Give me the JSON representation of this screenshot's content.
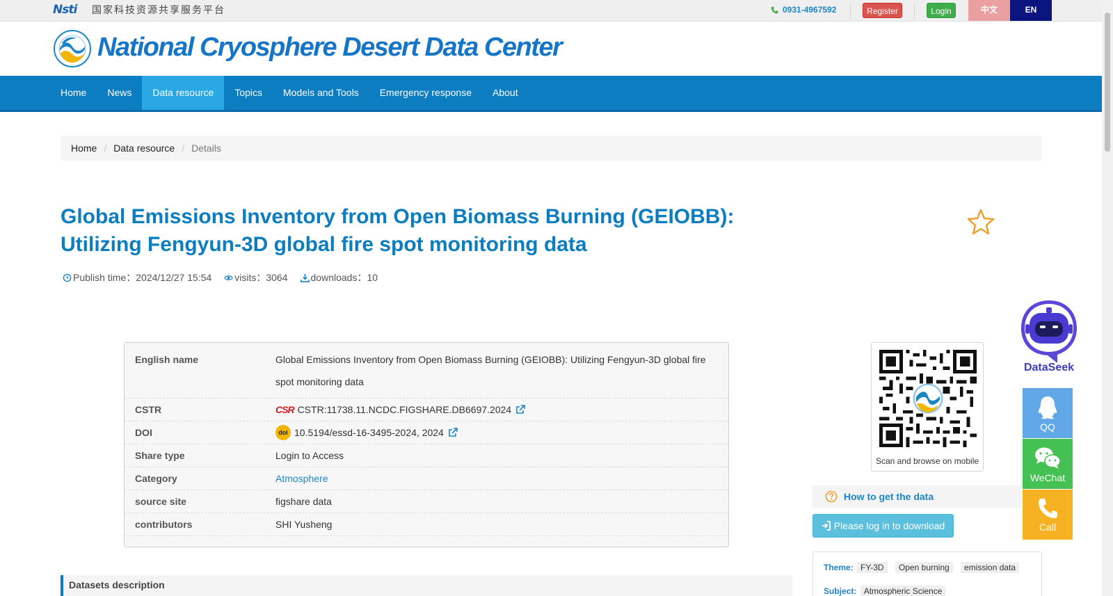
{
  "topbar": {
    "logo_mark": "Nsti",
    "logo_text": "国家科技资源共享服务平台",
    "phone": "0931-4967592",
    "register_label": "Register",
    "login_label": "Login",
    "lang_zh": "中文",
    "lang_en": "EN"
  },
  "header": {
    "site_title": "National Cryosphere Desert Data Center"
  },
  "nav": {
    "items": [
      {
        "label": "Home"
      },
      {
        "label": "News"
      },
      {
        "label": "Data resource"
      },
      {
        "label": "Topics"
      },
      {
        "label": "Models and Tools"
      },
      {
        "label": "Emergency response"
      },
      {
        "label": "About"
      }
    ],
    "active_index": 2
  },
  "breadcrumb": {
    "home": "Home",
    "section": "Data resource",
    "current": "Details"
  },
  "dataset": {
    "title": "Global Emissions Inventory from Open Biomass Burning (GEIOBB): Utilizing Fengyun-3D global fire spot monitoring data",
    "publish_time": "Publish time：2024/12/27 15:54",
    "visits": "visits：3064",
    "downloads": "downloads：10"
  },
  "info": {
    "english_name_key": "English name",
    "english_name": "Global Emissions Inventory from Open Biomass Burning (GEIOBB): Utilizing Fengyun-3D global fire spot monitoring data",
    "cstr_key": "CSTR",
    "cstr_badge": "CSR",
    "cstr": "CSTR:11738.11.NCDC.FIGSHARE.DB6697.2024",
    "doi_key": "DOI",
    "doi_badge": "doi",
    "doi": "10.5194/essd-16-3495-2024, 2024",
    "share_type_key": "Share type",
    "share_type": "Login to Access",
    "category_key": "Category",
    "category": "Atmosphere",
    "source_site_key": "source site",
    "source_site": "figshare data",
    "contributors_key": "contributors",
    "contributors": "SHI Yusheng"
  },
  "sections": {
    "description_title": "Datasets description"
  },
  "sidebar": {
    "qr_caption": "Scan and browse on mobile",
    "how_to_get": "How to get the data",
    "download_label": "Please log in to download",
    "theme_label": "Theme:",
    "themes": [
      "FY-3D",
      "Open burning",
      "emission data"
    ],
    "subject_label": "Subject:",
    "subject": "Atmospheric Science"
  },
  "floating": {
    "dataseek": "DataSeek",
    "qq": "QQ",
    "wechat": "WeChat",
    "call": "Call"
  },
  "colors": {
    "primary": "#0b7dc0",
    "nav_active": "#2aa7e5",
    "register": "#d9534f",
    "login": "#3fae4a",
    "lang_en": "#0b1580",
    "star": "#f0a030"
  }
}
